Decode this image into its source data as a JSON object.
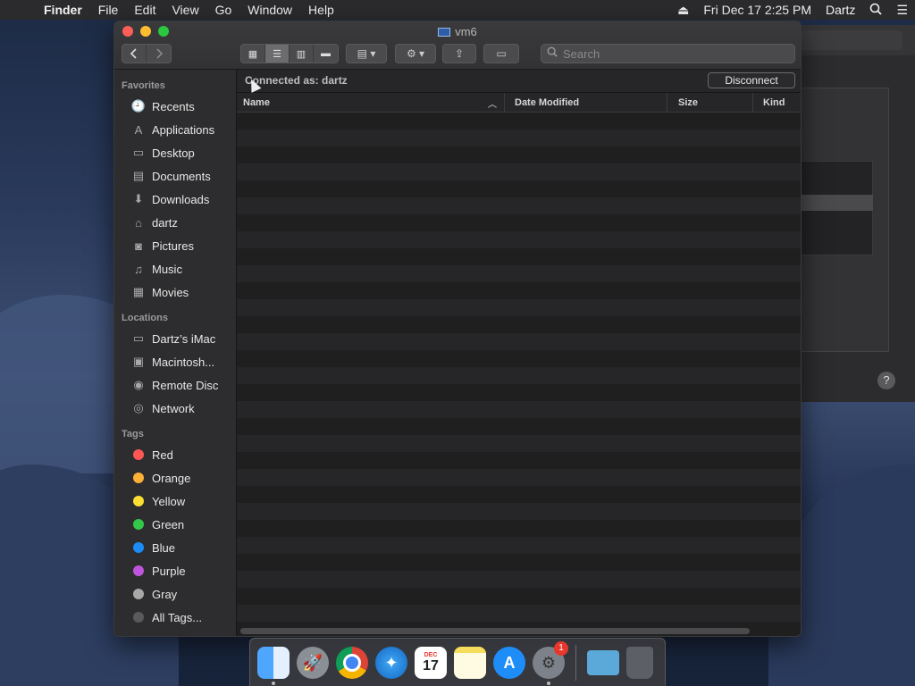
{
  "menubar": {
    "apple": "",
    "app": "Finder",
    "items": [
      "File",
      "Edit",
      "View",
      "Go",
      "Window",
      "Help"
    ],
    "datetime": "Fri Dec 17  2:25 PM",
    "user": "Dartz"
  },
  "window": {
    "title": "vm6",
    "search_placeholder": "Search",
    "connected_as": "Connected as: dartz",
    "disconnect_label": "Disconnect",
    "columns": {
      "name": "Name",
      "date": "Date Modified",
      "size": "Size",
      "kind": "Kind"
    }
  },
  "sidebar": {
    "favorites_header": "Favorites",
    "favorites": [
      {
        "label": "Recents",
        "icon": "clock-icon",
        "glyph": "🕘"
      },
      {
        "label": "Applications",
        "icon": "applications-icon",
        "glyph": "A"
      },
      {
        "label": "Desktop",
        "icon": "desktop-icon",
        "glyph": "▭"
      },
      {
        "label": "Documents",
        "icon": "documents-icon",
        "glyph": "▤"
      },
      {
        "label": "Downloads",
        "icon": "downloads-icon",
        "glyph": "⬇"
      },
      {
        "label": "dartz",
        "icon": "home-icon",
        "glyph": "⌂"
      },
      {
        "label": "Pictures",
        "icon": "camera-icon",
        "glyph": "◙"
      },
      {
        "label": "Music",
        "icon": "music-icon",
        "glyph": "♫"
      },
      {
        "label": "Movies",
        "icon": "film-icon",
        "glyph": "▦"
      }
    ],
    "locations_header": "Locations",
    "locations": [
      {
        "label": "Dartz’s iMac",
        "icon": "computer-icon",
        "glyph": "▭"
      },
      {
        "label": "Macintosh...",
        "icon": "hard-drive-icon",
        "glyph": "▣"
      },
      {
        "label": "Remote Disc",
        "icon": "disc-icon",
        "glyph": "◉"
      },
      {
        "label": "Network",
        "icon": "globe-icon",
        "glyph": "◎"
      }
    ],
    "tags_header": "Tags",
    "tags": [
      {
        "label": "Red",
        "color": "#fc5753"
      },
      {
        "label": "Orange",
        "color": "#fdb036"
      },
      {
        "label": "Yellow",
        "color": "#fddf33"
      },
      {
        "label": "Green",
        "color": "#34c84a"
      },
      {
        "label": "Blue",
        "color": "#1c8bf5"
      },
      {
        "label": "Purple",
        "color": "#c055dd"
      },
      {
        "label": "Gray",
        "color": "#a8a8a8"
      },
      {
        "label": "All Tags...",
        "color": "#5a5a5a"
      }
    ]
  },
  "dock": {
    "calendar_month": "DEC",
    "calendar_day": "17",
    "prefs_badge": "1"
  }
}
